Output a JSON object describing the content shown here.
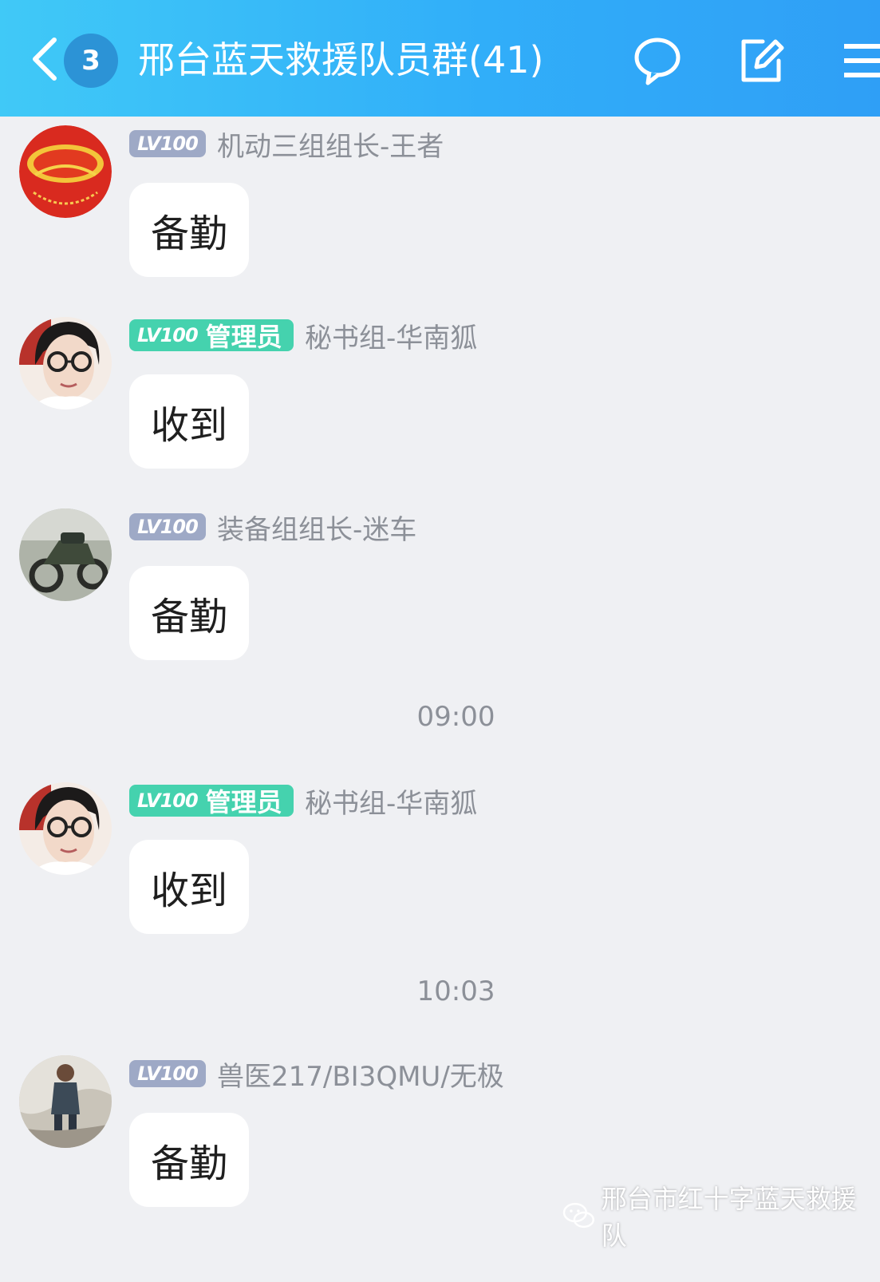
{
  "header": {
    "title": "邢台蓝天救援队员群(41)",
    "unread_count": "3",
    "icons": [
      "back-arrow-icon",
      "chat-bubble-icon",
      "edit-icon",
      "menu-icon"
    ]
  },
  "messages": [
    {
      "level": "LV100",
      "role": "",
      "sender": "机动三组组长-王者",
      "text": "备勤",
      "avatar": "red-gratitude-emblem"
    },
    {
      "level": "LV100",
      "role": "管理员",
      "sender": "秘书组-华南狐",
      "text": "收到",
      "avatar": "woman-with-glasses"
    },
    {
      "level": "LV100",
      "role": "",
      "sender": "装备组组长-迷车",
      "text": "备勤",
      "avatar": "motorcycle-sidecar"
    },
    {
      "level": "LV100",
      "role": "管理员",
      "sender": "秘书组-华南狐",
      "text": "收到",
      "avatar": "woman-with-glasses"
    },
    {
      "level": "LV100",
      "role": "",
      "sender": "兽医217/BI3QMU/无极",
      "text": "备勤",
      "avatar": "man-outdoors"
    }
  ],
  "timestamps": [
    "09:00",
    "10:03"
  ],
  "watermark": "邢台市红十字蓝天救援队",
  "colors": {
    "header_gradient_start": "#40c9f7",
    "header_gradient_end": "#2f9ff6",
    "admin_badge": "#45d2ae",
    "level_badge": "#9ea9c6",
    "background": "#eff0f3"
  }
}
